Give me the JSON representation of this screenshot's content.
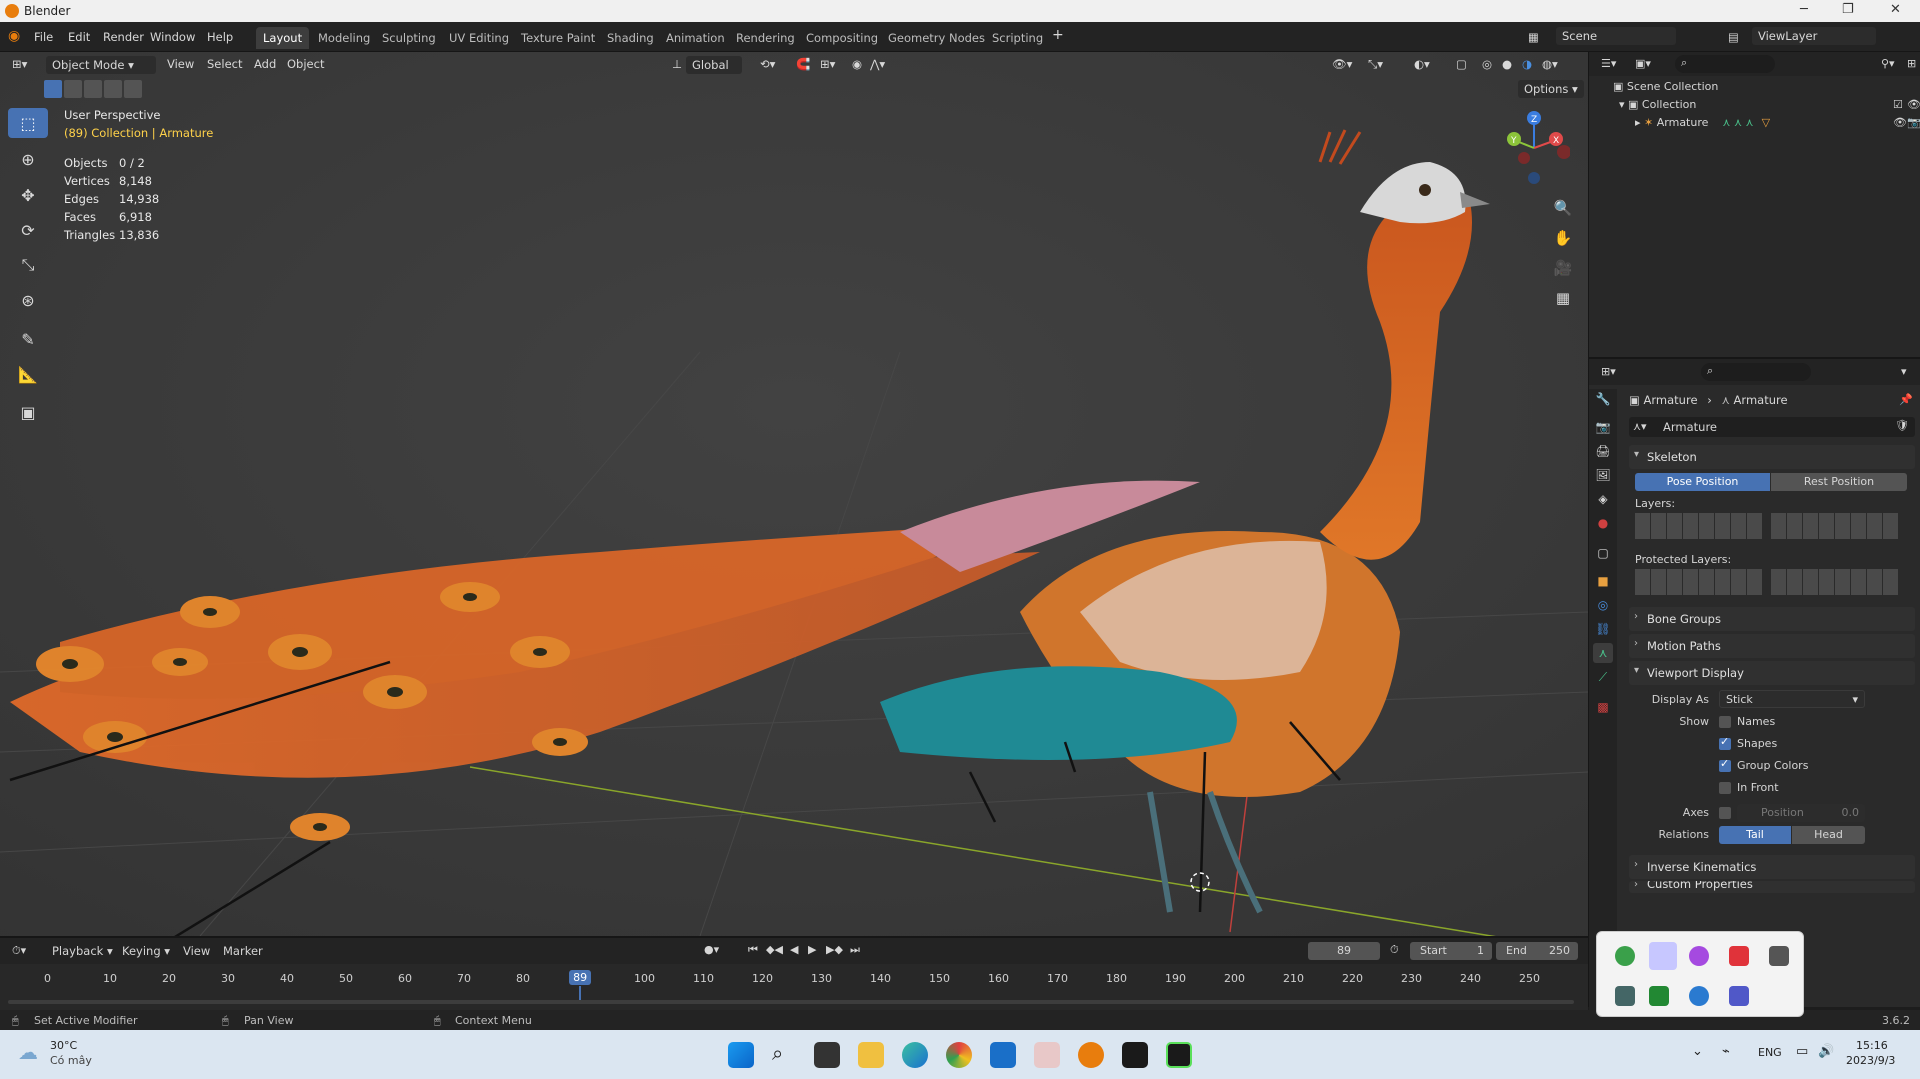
{
  "window": {
    "title": "Blender"
  },
  "menu": [
    "File",
    "Edit",
    "Render",
    "Window",
    "Help"
  ],
  "workspaces": [
    "Layout",
    "Modeling",
    "Sculpting",
    "UV Editing",
    "Texture Paint",
    "Shading",
    "Animation",
    "Rendering",
    "Compositing",
    "Geometry Nodes",
    "Scripting"
  ],
  "active_workspace": "Layout",
  "scene": "Scene",
  "view_layer": "ViewLayer",
  "viewport": {
    "mode": "Object Mode",
    "menus": [
      "View",
      "Select",
      "Add",
      "Object"
    ],
    "orientation": "Global",
    "options": "Options",
    "view_name": "User Perspective",
    "collection_info": "(89) Collection | Armature",
    "stats": [
      {
        "label": "Objects",
        "value": "0 / 2"
      },
      {
        "label": "Vertices",
        "value": "8,148"
      },
      {
        "label": "Edges",
        "value": "14,938"
      },
      {
        "label": "Faces",
        "value": "6,918"
      },
      {
        "label": "Triangles",
        "value": "13,836"
      }
    ],
    "gizmo": {
      "x": "X",
      "y": "Y",
      "z": "Z"
    }
  },
  "outliner": {
    "scene_collection": "Scene Collection",
    "collection": "Collection",
    "armature": "Armature"
  },
  "properties": {
    "breadcrumb_object": "Armature",
    "breadcrumb_data": "Armature",
    "data_name": "Armature",
    "skeleton": {
      "title": "Skeleton",
      "pose_position": "Pose Position",
      "rest_position": "Rest Position",
      "layers": "Layers:",
      "protected_layers": "Protected Layers:"
    },
    "bone_groups": "Bone Groups",
    "motion_paths": "Motion Paths",
    "viewport_display": {
      "title": "Viewport Display",
      "display_as_label": "Display As",
      "display_as_value": "Stick",
      "show_label": "Show",
      "names": "Names",
      "shapes": "Shapes",
      "group_colors": "Group Colors",
      "in_front": "In Front",
      "axes_label": "Axes",
      "position_label": "Position",
      "position_value": "0.0",
      "relations_label": "Relations",
      "tail": "Tail",
      "head": "Head"
    },
    "inverse_kinematics": "Inverse Kinematics",
    "custom_properties": "Custom Properties"
  },
  "timeline": {
    "menus": [
      "Playback",
      "Keying",
      "View",
      "Marker"
    ],
    "current_frame": "89",
    "start_label": "Start",
    "start_value": "1",
    "end_label": "End",
    "end_value": "250",
    "ticks": [
      "0",
      "10",
      "20",
      "30",
      "40",
      "50",
      "60",
      "70",
      "80",
      "89",
      "100",
      "110",
      "120",
      "130",
      "140",
      "150",
      "160",
      "170",
      "180",
      "190",
      "200",
      "210",
      "220",
      "230",
      "240",
      "250"
    ]
  },
  "status": {
    "left": "Set Active Modifier",
    "middle": "Pan View",
    "right": "Context Menu",
    "version": "3.6.2"
  },
  "taskbar": {
    "weather_temp": "30°C",
    "weather_desc": "Có mây",
    "lang": "ENG",
    "time": "15:16",
    "date": "2023/9/3"
  }
}
